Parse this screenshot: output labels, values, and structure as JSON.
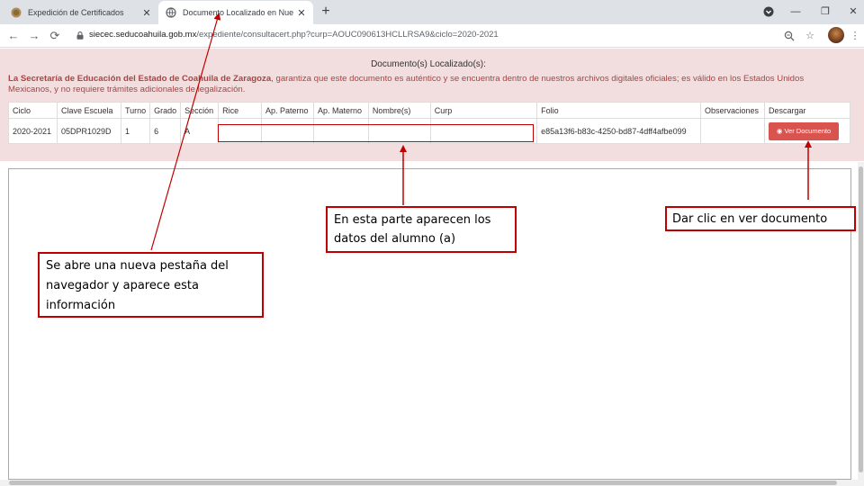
{
  "browser": {
    "tabs": [
      {
        "title": "Expedición de Certificados",
        "active": false
      },
      {
        "title": "Documento Localizado en Nuest",
        "active": true
      }
    ],
    "new_tab_label": "+",
    "address": {
      "host": "siecec.seducoahuila.gob.mx",
      "path": "/expediente/consultacert.php?curp=AOUC090613HCLLRSA9&ciclo=2020-2021"
    },
    "icons": {
      "back": "back-arrow-icon",
      "forward": "forward-arrow-icon",
      "reload": "reload-icon",
      "lock": "lock-icon",
      "zoom": "zoom-icon",
      "star": "bookmark-star-icon",
      "menu": "kebab-menu-icon"
    }
  },
  "page": {
    "heading": "Documento(s) Localizado(s):",
    "notice_bold": "La Secretaría de Educación del Estado de Coahuila de Zaragoza",
    "notice_rest": ", garantiza que este documento es auténtico y se encuentra dentro de nuestros archivos digitales oficiales; es válido en los Estados Unidos Mexicanos, y no requiere trámites adicionales de legalización.",
    "table": {
      "headers": [
        "Ciclo",
        "Clave Escuela",
        "Turno",
        "Grado",
        "Sección",
        "Rice",
        "Ap. Paterno",
        "Ap. Materno",
        "Nombre(s)",
        "Curp",
        "Folio",
        "Observaciones",
        "Descargar"
      ],
      "row": {
        "ciclo": "2020-2021",
        "clave": "05DPR1029D",
        "turno": "1",
        "grado": "6",
        "seccion": "A",
        "folio": "e85a13f6-b83c-4250-bd87-4dff4afbe099",
        "observaciones": "",
        "button_label": "Ver Documento"
      }
    }
  },
  "annotations": {
    "data": "En esta parte aparecen los datos del alumno (a)",
    "tab": "Se abre una nueva pestaña del navegador y aparece esta información",
    "click": "Dar clic en ver documento"
  },
  "colors": {
    "accent_red": "#c00000",
    "panel_bg": "#f2dede",
    "notice_text": "#a94442",
    "button": "#d9534f"
  }
}
